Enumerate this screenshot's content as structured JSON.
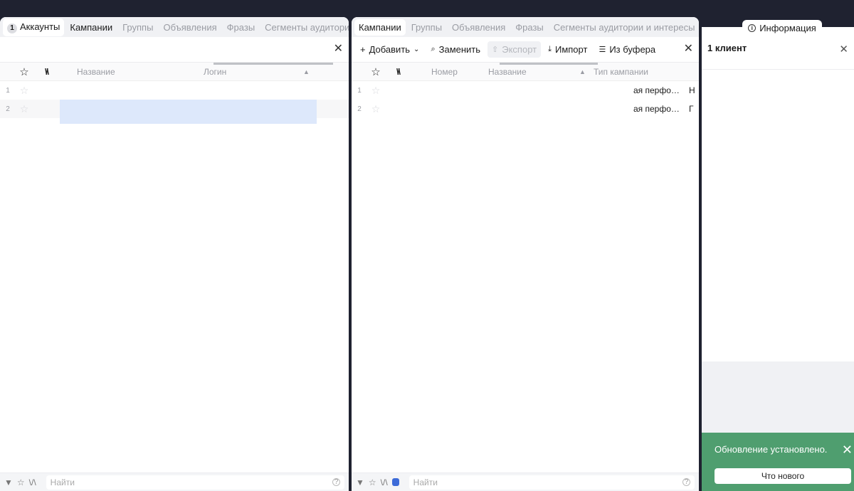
{
  "left": {
    "tabs": [
      {
        "count": "1",
        "label": "Аккаунты"
      },
      {
        "label": "Кампании"
      },
      {
        "label": "Группы"
      },
      {
        "label": "Объявления"
      },
      {
        "label": "Фразы"
      },
      {
        "label": "Сегменты аудитории и интересы"
      }
    ],
    "columns": {
      "name": "Название",
      "login": "Логин"
    },
    "rows": [
      {
        "num": "1"
      },
      {
        "num": "2"
      }
    ],
    "search_placeholder": "Найти"
  },
  "middle": {
    "tabs": [
      {
        "label": "Кампании"
      },
      {
        "label": "Группы"
      },
      {
        "label": "Объявления"
      },
      {
        "label": "Фразы"
      },
      {
        "label": "Сегменты аудитории и интересы"
      }
    ],
    "toolbar": {
      "add": "Добавить",
      "replace": "Заменить",
      "export": "Экспорт",
      "import": "Импорт",
      "from_buffer": "Из буфера"
    },
    "columns": {
      "number": "Номер",
      "name": "Название",
      "type": "Тип кампании"
    },
    "rows": [
      {
        "num": "1",
        "type": "ая перфо…",
        "extra": "Н"
      },
      {
        "num": "2",
        "type": "ая перфо…",
        "extra": "Г"
      }
    ],
    "search_placeholder": "Найти"
  },
  "right": {
    "info_tab": "Информация",
    "header": "1 клиент"
  },
  "toast": {
    "message": "Обновление установлено.",
    "button": "Что нового"
  }
}
